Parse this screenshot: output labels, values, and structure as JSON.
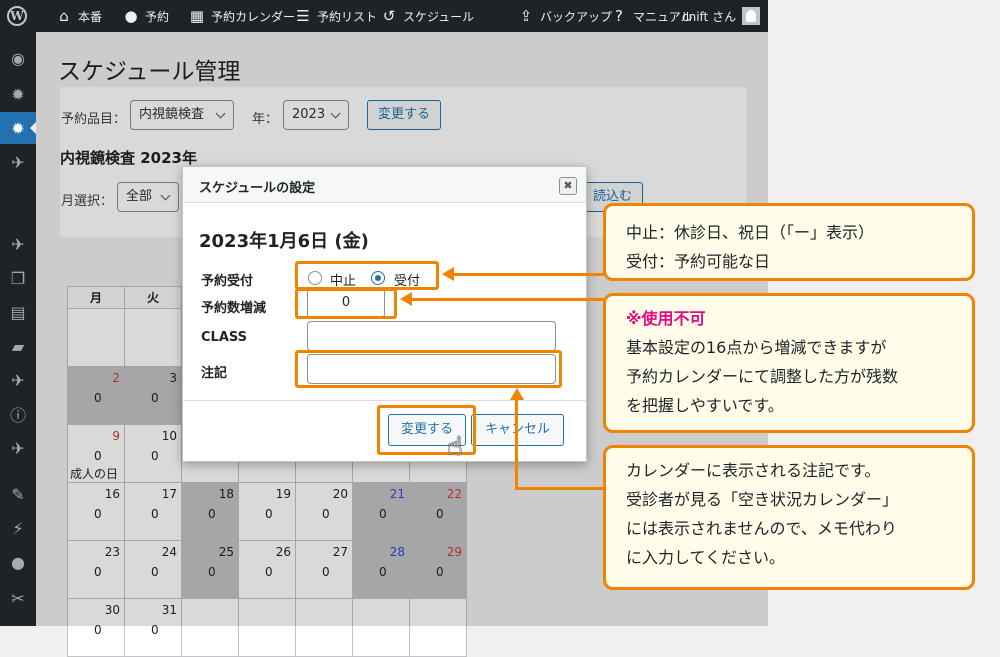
{
  "adminbar": {
    "items": [
      {
        "label": "本番",
        "icon": "home-icon",
        "glyph": "⌂"
      },
      {
        "label": "予約",
        "icon": "circle-icon",
        "glyph": "●"
      },
      {
        "label": "予約カレンダー",
        "icon": "calendar-icon",
        "glyph": "▦"
      },
      {
        "label": "予約リスト",
        "icon": "list-icon",
        "glyph": "☰"
      },
      {
        "label": "スケジュール",
        "icon": "history-icon",
        "glyph": "↺"
      },
      {
        "label": "バックアップ",
        "icon": "upload-icon",
        "glyph": "⇪"
      },
      {
        "label": "マニュアル",
        "icon": "help-icon",
        "glyph": "?"
      },
      {
        "label": "cnift さん",
        "icon": "",
        "glyph": ""
      }
    ]
  },
  "sidebar": {
    "icons": [
      "dashboard-icon",
      "settings-icon",
      "settings-active-icon",
      "pin-icon",
      "pin-icon",
      "media-icon",
      "pages-icon",
      "comments-icon",
      "pin-icon",
      "info-icon",
      "pin-icon",
      "appearance-icon",
      "plugins-icon",
      "users-icon",
      "tools-icon"
    ],
    "glyphs": [
      "◉",
      "✹",
      "✹",
      "✈",
      "✈",
      "❐",
      "▤",
      "▰",
      "✈",
      "ⓘ",
      "✈",
      "✎",
      "⚡",
      "●",
      "✂"
    ]
  },
  "page": {
    "title": "スケジュール管理",
    "item_label": "予約品目：",
    "item_value": "内視鏡検査",
    "year_label": "年：",
    "year_value": "2023",
    "change_button": "変更する",
    "subtitle": "内視鏡検査 2023年",
    "month_label": "月選択：",
    "month_value": "全部",
    "load_button": "読込む"
  },
  "calendar": {
    "headers": [
      "月",
      "火",
      "",
      "",
      "",
      "",
      ""
    ],
    "rows": [
      [
        {
          "d": "",
          "c": "",
          "n": "",
          "off": false
        },
        {
          "d": "",
          "c": "",
          "n": "",
          "off": false
        },
        {
          "d": "",
          "c": "",
          "n": "",
          "off": false
        },
        {
          "d": "",
          "c": "",
          "n": "",
          "off": false
        },
        {
          "d": "",
          "c": "",
          "n": "",
          "off": false
        },
        {
          "d": "",
          "c": "",
          "n": "",
          "off": false
        },
        {
          "d": "",
          "c": "",
          "n": "",
          "off": false
        }
      ],
      [
        {
          "d": "2",
          "c": "0",
          "n": "",
          "off": true,
          "cls": "red"
        },
        {
          "d": "3",
          "c": "0",
          "n": "",
          "off": true
        },
        {
          "d": "",
          "c": "",
          "n": "",
          "off": false
        },
        {
          "d": "",
          "c": "",
          "n": "",
          "off": false
        },
        {
          "d": "",
          "c": "",
          "n": "",
          "off": false
        },
        {
          "d": "",
          "c": "",
          "n": "",
          "off": false
        },
        {
          "d": "",
          "c": "",
          "n": "",
          "off": false
        }
      ],
      [
        {
          "d": "9",
          "c": "0",
          "n": "成人の日",
          "off": false,
          "cls": "red"
        },
        {
          "d": "10",
          "c": "0",
          "n": "",
          "off": false
        },
        {
          "d": "",
          "c": "",
          "n": "",
          "off": false
        },
        {
          "d": "",
          "c": "",
          "n": "",
          "off": false
        },
        {
          "d": "",
          "c": "",
          "n": "",
          "off": false
        },
        {
          "d": "",
          "c": "",
          "n": "",
          "off": false
        },
        {
          "d": "",
          "c": "",
          "n": "",
          "off": false
        }
      ],
      [
        {
          "d": "16",
          "c": "0",
          "n": "",
          "off": false
        },
        {
          "d": "17",
          "c": "0",
          "n": "",
          "off": false
        },
        {
          "d": "18",
          "c": "0",
          "n": "",
          "off": true
        },
        {
          "d": "19",
          "c": "0",
          "n": "",
          "off": false
        },
        {
          "d": "20",
          "c": "0",
          "n": "",
          "off": false
        },
        {
          "d": "21",
          "c": "0",
          "n": "",
          "off": true,
          "cls": "blue"
        },
        {
          "d": "22",
          "c": "0",
          "n": "",
          "off": true,
          "cls": "red"
        }
      ],
      [
        {
          "d": "23",
          "c": "0",
          "n": "",
          "off": false
        },
        {
          "d": "24",
          "c": "0",
          "n": "",
          "off": false
        },
        {
          "d": "25",
          "c": "0",
          "n": "",
          "off": true
        },
        {
          "d": "26",
          "c": "0",
          "n": "",
          "off": false
        },
        {
          "d": "27",
          "c": "0",
          "n": "",
          "off": false
        },
        {
          "d": "28",
          "c": "0",
          "n": "",
          "off": true,
          "cls": "blue"
        },
        {
          "d": "29",
          "c": "0",
          "n": "",
          "off": true,
          "cls": "red"
        }
      ],
      [
        {
          "d": "30",
          "c": "0",
          "n": "",
          "off": false
        },
        {
          "d": "31",
          "c": "0",
          "n": "",
          "off": false
        },
        {
          "d": "",
          "c": "",
          "n": "",
          "off": false
        },
        {
          "d": "",
          "c": "",
          "n": "",
          "off": false
        },
        {
          "d": "",
          "c": "",
          "n": "",
          "off": false
        },
        {
          "d": "",
          "c": "",
          "n": "",
          "off": false
        },
        {
          "d": "",
          "c": "",
          "n": "",
          "off": false
        }
      ]
    ]
  },
  "dialog": {
    "title": "スケジュールの設定",
    "close": "✖",
    "date": "2023年1月6日 (金)",
    "reception_label": "予約受付",
    "option_stop": "中止",
    "option_accept": "受付",
    "count_label": "予約数増減",
    "count_value": "0",
    "class_label": "CLASS",
    "class_value": "",
    "note_label": "注記",
    "note_value": "",
    "submit": "変更する",
    "cancel": "キャンセル"
  },
  "callouts": {
    "first": [
      "中止：休診日、祝日（「ー」表示）",
      "受付：予約可能な日"
    ],
    "second_title": "※使用不可",
    "second": [
      "基本設定の16点から増減できますが",
      "予約カレンダーにて調整した方が残数",
      "を把握しやすいです。"
    ],
    "third": [
      "カレンダーに表示される注記です。",
      "受診者が見る「空き状況カレンダー」",
      "には表示されませんので、メモ代わり",
      "に入力してください。"
    ]
  },
  "colors": {
    "highlight": "#f08300",
    "callout_bg": "#fffdea",
    "warning": "#e5097f",
    "primary": "#2271b1"
  }
}
